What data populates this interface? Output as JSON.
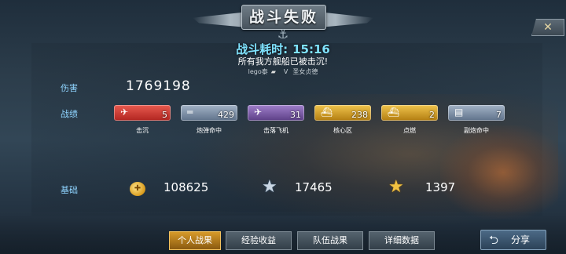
{
  "header": {
    "title": "战斗失败",
    "close_label": "✕",
    "anchor_icon": "anchor-icon"
  },
  "battle": {
    "time_label": "战斗耗时:",
    "time_value": "15:16",
    "message": "所有我方舰船已被击沉!",
    "player_left": "lego泰",
    "vs": "V",
    "player_right": "圣女贞德"
  },
  "damage": {
    "label": "伤害",
    "value": "1769198"
  },
  "stats": {
    "label": "战绩",
    "items": [
      {
        "caption": "击沉",
        "count": "5",
        "color": "#d2372f",
        "icon": "plane-sink-icon"
      },
      {
        "caption": "炮弹命中",
        "count": "429",
        "color": "#7a8fa8",
        "icon": "cannon-icon"
      },
      {
        "caption": "击落飞机",
        "count": "31",
        "color": "#7d58a8",
        "icon": "aircraft-icon"
      },
      {
        "caption": "核心区",
        "count": "238",
        "color": "#d8a21e",
        "icon": "ship-core-icon"
      },
      {
        "caption": "点燃",
        "count": "2",
        "color": "#d8a21e",
        "icon": "fire-icon"
      },
      {
        "caption": "副炮命中",
        "count": "7",
        "color": "#7a8fa8",
        "icon": "secondary-gun-icon"
      }
    ]
  },
  "base": {
    "label": "基础",
    "coins": "108625",
    "silver_star": "17465",
    "gold_star": "1397"
  },
  "tabs": [
    {
      "label": "个人战果",
      "active": true
    },
    {
      "label": "经验收益",
      "active": false
    },
    {
      "label": "队伍战果",
      "active": false
    },
    {
      "label": "详细数据",
      "active": false
    }
  ],
  "share": {
    "label": "分享"
  }
}
